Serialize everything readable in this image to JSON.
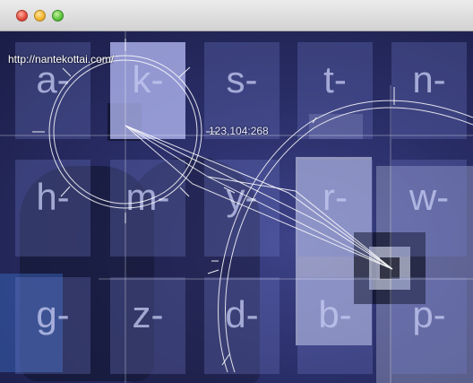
{
  "window": {
    "buttons": {
      "close": "close-button",
      "minimize": "minimize-button",
      "maximize": "zoom-button"
    }
  },
  "overlay": {
    "url": "http://nantekottai.com/",
    "coordinates": "123,104:268"
  },
  "keyboard": {
    "rows": [
      [
        "a-",
        "k-",
        "s-",
        "t-",
        "n-"
      ],
      [
        "h-",
        "m-",
        "y-",
        "r-",
        "w-"
      ],
      [
        "g-",
        "z-",
        "d-",
        "b-",
        "p-"
      ]
    ],
    "active_key": "k-"
  },
  "colors": {
    "cell": "#7880d2",
    "active_cell": "#bec3ff",
    "label": "#c3c8f0",
    "overlay_lines": "#ffffff"
  }
}
